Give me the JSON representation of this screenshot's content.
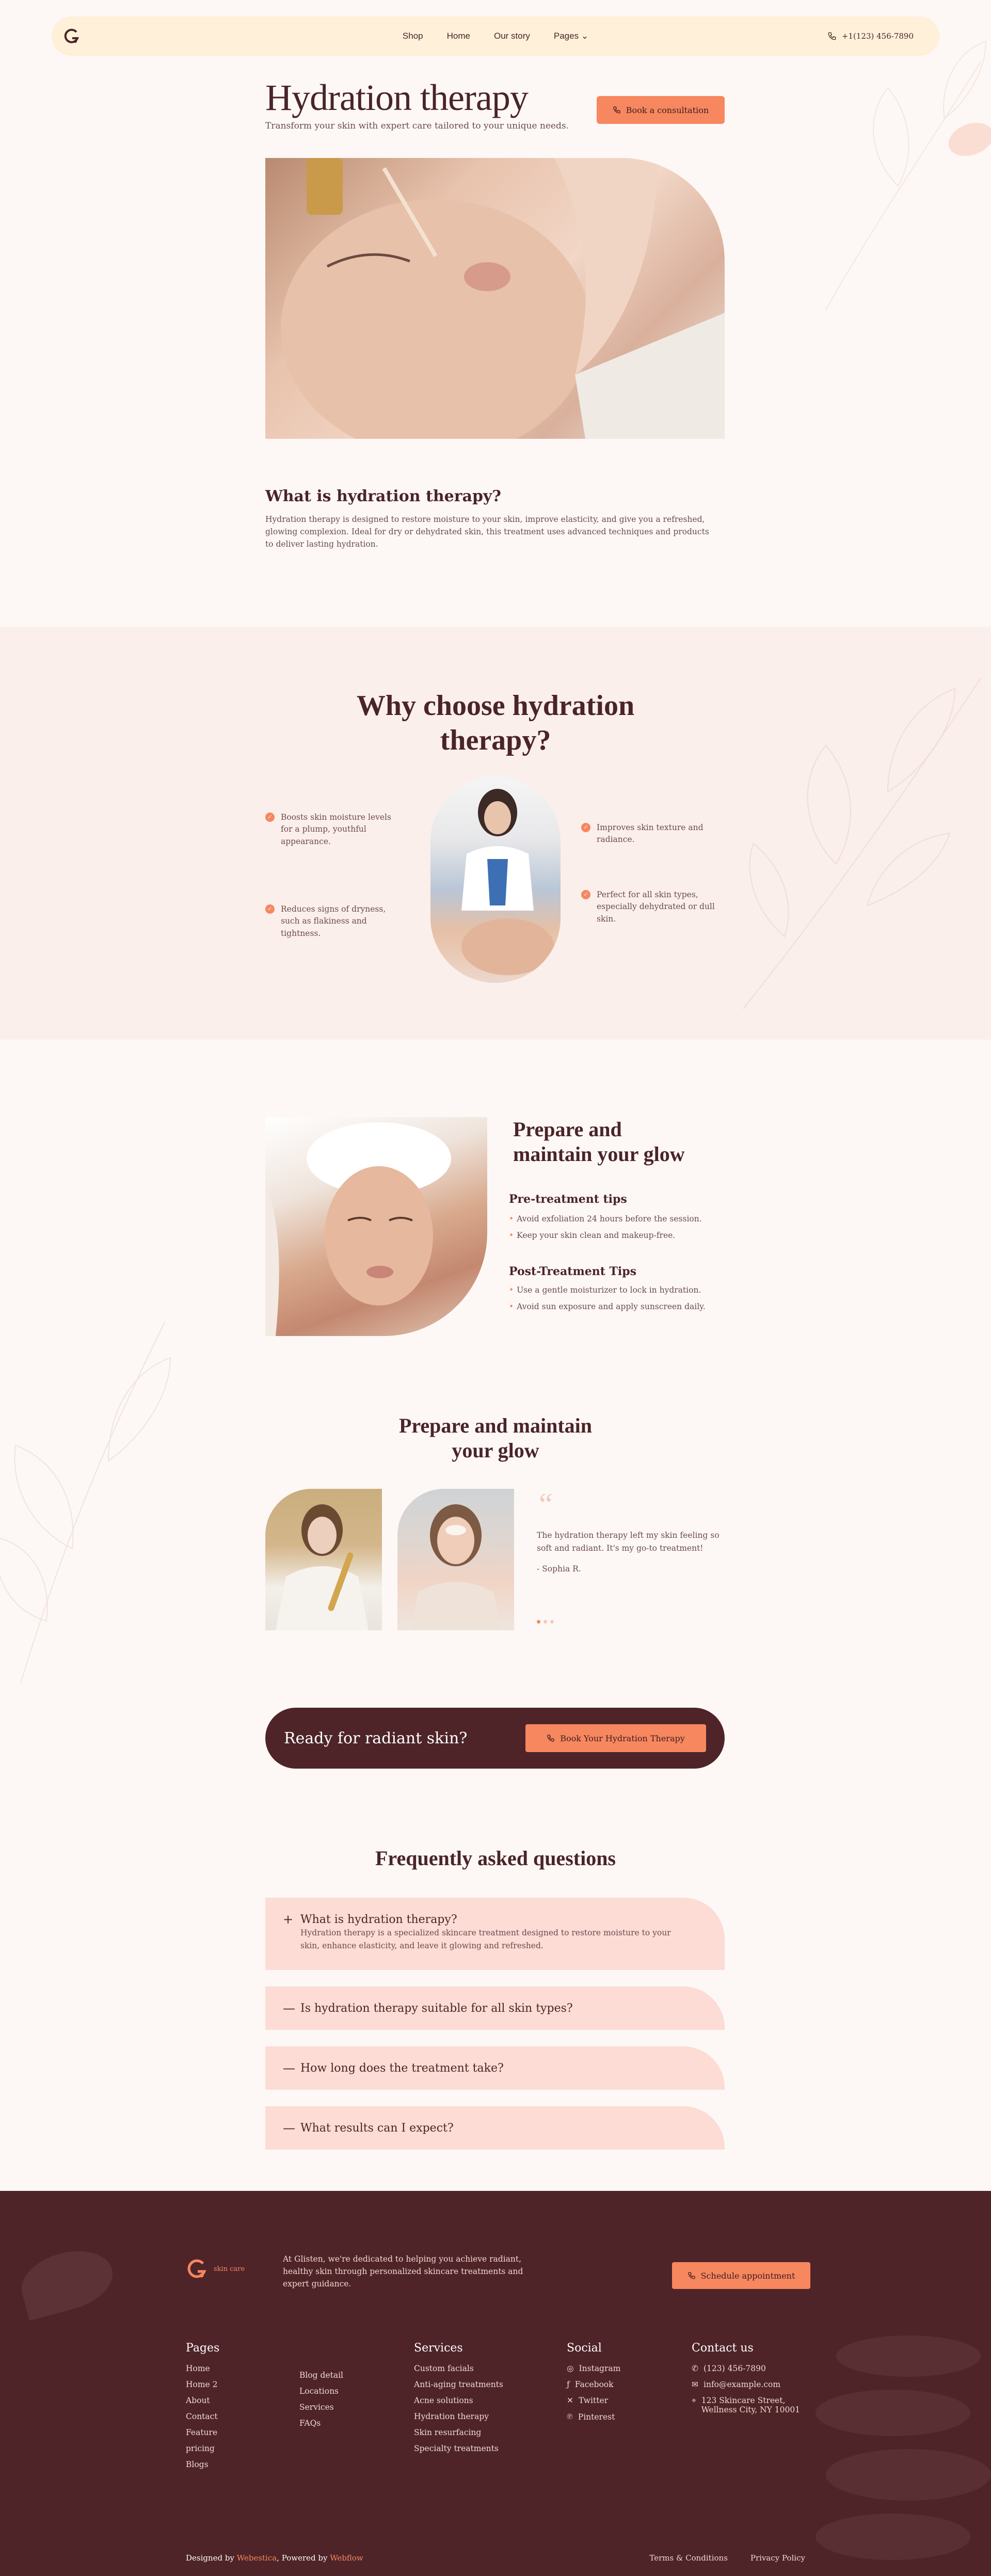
{
  "nav": {
    "links": [
      "Shop",
      "Home",
      "Our story",
      "Pages"
    ],
    "phone": "+1(123) 456-7890"
  },
  "hero": {
    "title": "Hydration therapy",
    "subtitle": "Transform your skin with expert care tailored to your unique needs.",
    "cta": "Book a consultation"
  },
  "what": {
    "title": "What is hydration therapy?",
    "text": "Hydration therapy is designed to restore moisture to your skin, improve elasticity, and give you a refreshed, glowing complexion. Ideal for dry or dehydrated skin, this treatment uses advanced techniques and products to deliver lasting hydration."
  },
  "why": {
    "title_line1": "Why choose hydration",
    "title_line2": "therapy?",
    "items": [
      "Boosts skin moisture levels for a plump, youthful appearance.",
      "Reduces signs of dryness, such as flakiness and tightness.",
      "Improves skin texture and radiance.",
      "Perfect for all skin types, especially dehydrated or dull skin."
    ]
  },
  "prepare": {
    "title_line1": "Prepare and",
    "title_line2": "maintain your glow",
    "pre_title": "Pre-treatment tips",
    "pre_tips": [
      "Avoid exfoliation 24 hours before the session.",
      "Keep your skin clean and makeup-free."
    ],
    "post_title": "Post-Treatment Tips",
    "post_tips": [
      "Use a gentle moisturizer to lock in hydration.",
      "Avoid sun exposure and apply sunscreen daily."
    ]
  },
  "testimonials": {
    "title_line1": "Prepare and maintain",
    "title_line2": "your glow",
    "quote": "The hydration therapy left my skin feeling so soft and radiant. It's my go-to treatment!",
    "author": "- Sophia R."
  },
  "cta": {
    "text": "Ready for radiant skin?",
    "button": "Book Your Hydration Therapy"
  },
  "faq": {
    "title": "Frequently asked questions",
    "items": [
      {
        "q": "What is hydration therapy?",
        "a": "Hydration therapy is a specialized skincare treatment designed to restore moisture to your skin, enhance elasticity, and leave it glowing and refreshed."
      },
      {
        "q": "Is hydration therapy suitable for all skin types?"
      },
      {
        "q": "How long does the treatment take?"
      },
      {
        "q": "What results can I expect?"
      }
    ]
  },
  "footer": {
    "brand": "skin care",
    "about": "At Glisten, we're dedicated to helping you achieve radiant, healthy skin through personalized skincare treatments and expert guidance.",
    "button": "Schedule appointment",
    "pages_title": "Pages",
    "pages_col1": [
      "Home",
      "Home 2",
      "About",
      "Contact",
      "Feature",
      "pricing",
      "Blogs"
    ],
    "pages_col2": [
      "Blog detail",
      "Locations",
      "Services",
      "FAQs"
    ],
    "services_title": "Services",
    "services": [
      "Custom facials",
      "Anti-aging treatments",
      "Acne solutions",
      "Hydration therapy",
      "Skin resurfacing",
      "Specialty treatments"
    ],
    "social_title": "Social",
    "social": [
      "Instagram",
      "Facebook",
      "Twitter",
      "Pinterest"
    ],
    "contact_title": "Contact us",
    "phone": "(123) 456-7890",
    "email": "info@example.com",
    "address_line1": "123 Skincare Street,",
    "address_line2": "Wellness City, NY 10001",
    "designed_prefix": "Designed by ",
    "designed_by": "Webestica",
    "powered_prefix": ", Powered by ",
    "powered_by": "Webflow",
    "terms": "Terms & Conditions",
    "privacy": "Privacy Policy"
  },
  "colors": {
    "accent": "#f7875f",
    "dark": "#4e2428",
    "nav_bg": "#fef0d9",
    "faq_bg": "#fcdcd4"
  }
}
